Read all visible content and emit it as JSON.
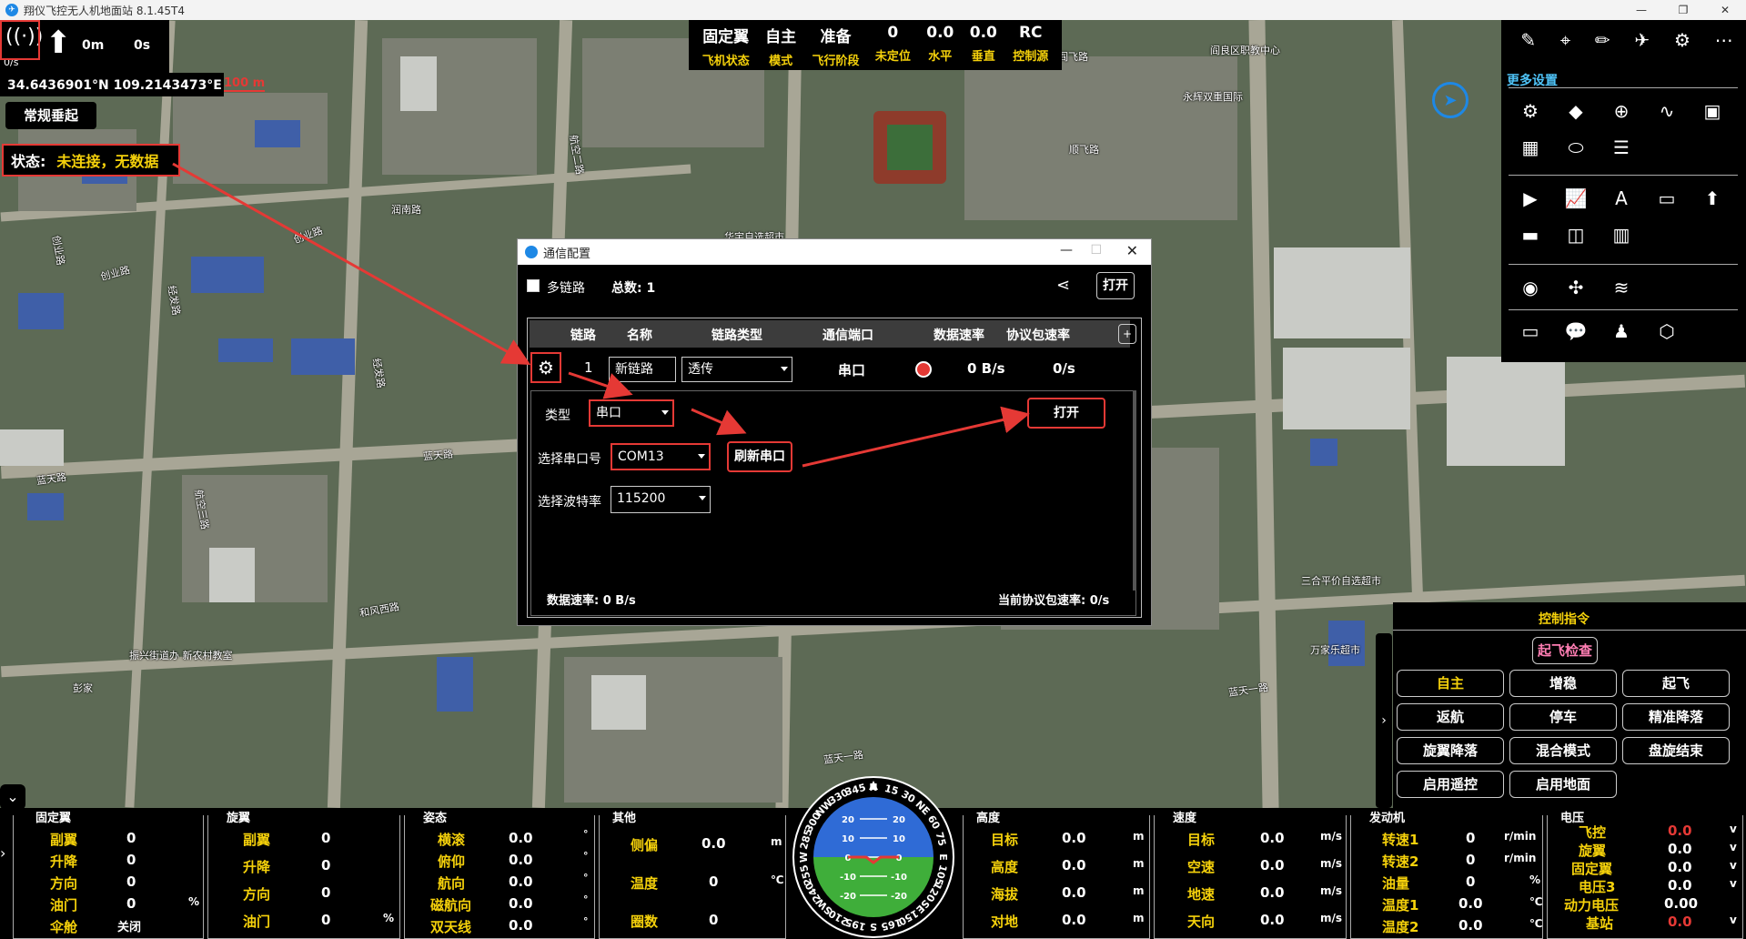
{
  "window": {
    "title": "翔仪飞控无人机地面站 8.1.45T4",
    "controls": [
      "—",
      "❐",
      "✕"
    ]
  },
  "top_left": {
    "signal": "0/s",
    "altitude": "0m",
    "time": "0s",
    "coords": "34.6436901°N 109.2143473°E",
    "scale": "100 m",
    "mode_button": "常规垂起",
    "status_label": "状态:",
    "status_value": "未连接，无数据"
  },
  "top_status": [
    {
      "value": "固定翼",
      "label": "飞机状态"
    },
    {
      "value": "自主",
      "label": "模式"
    },
    {
      "value": "准备",
      "label": "飞行阶段"
    },
    {
      "value": "0",
      "label": "未定位"
    },
    {
      "value": "0.0",
      "label": "水平"
    },
    {
      "value": "0.0",
      "label": "垂直"
    },
    {
      "value": "RC",
      "label": "控制源"
    }
  ],
  "right_panel": {
    "more_settings": "更多设置"
  },
  "map_labels": [
    "阎良区职教中心",
    "永辉双重国际",
    "航空二路",
    "华宇自选超市",
    "创业路",
    "润南路",
    "创业路",
    "经发路",
    "航空三路",
    "经发路",
    "创业路",
    "蓝天路",
    "蓝天路",
    "和风西路",
    "振兴街道办 新农村教室",
    "彭家",
    "三合平价自选超市",
    "万家乐超市",
    "蓝天一路",
    "蓝天一路",
    "顺飞路",
    "阎飞路"
  ],
  "dialog": {
    "title": "通信配置",
    "multi_link": "多链路",
    "total": "总数: 1",
    "open": "打开",
    "headers": [
      "链路",
      "名称",
      "链路类型",
      "通信端口",
      "数据速率",
      "协议包速率"
    ],
    "row": {
      "index": "1",
      "name": "新链路",
      "type": "透传",
      "port": "串口",
      "rate": "0 B/s",
      "pkt_rate": "0/s"
    },
    "detail": {
      "type_label": "类型",
      "type_value": "串口",
      "port_label": "选择串口号",
      "port_value": "COM13",
      "refresh": "刷新串口",
      "baud_label": "选择波特率",
      "baud_value": "115200",
      "open": "打开",
      "data_rate": "数据速率: 0 B/s",
      "pkt_rate": "当前协议包速率: 0/s"
    }
  },
  "control": {
    "title": "控制指令",
    "check": "起飞检查",
    "buttons": [
      "自主",
      "增稳",
      "起飞",
      "返航",
      "停车",
      "精准降落",
      "旋翼降落",
      "混合模式",
      "盘旋结束",
      "启用遥控",
      "启用地面"
    ]
  },
  "bottom": {
    "fixed_wing": {
      "title": "固定翼",
      "rows": [
        [
          "副翼",
          "0",
          ""
        ],
        [
          "升降",
          "0",
          ""
        ],
        [
          "方向",
          "0",
          ""
        ],
        [
          "油门",
          "0",
          "%"
        ],
        [
          "伞舱",
          "关闭",
          ""
        ]
      ]
    },
    "rotor": {
      "title": "旋翼",
      "rows": [
        [
          "副翼",
          "0",
          ""
        ],
        [
          "升降",
          "0",
          ""
        ],
        [
          "方向",
          "0",
          ""
        ],
        [
          "油门",
          "0",
          "%"
        ]
      ]
    },
    "attitude": {
      "title": "姿态",
      "rows": [
        [
          "横滚",
          "0.0",
          "°"
        ],
        [
          "俯仰",
          "0.0",
          "°"
        ],
        [
          "航向",
          "0.0",
          "°"
        ],
        [
          "磁航向",
          "0.0",
          "°"
        ],
        [
          "双天线",
          "0.0",
          "°"
        ]
      ]
    },
    "other": {
      "title": "其他",
      "rows": [
        [
          "侧偏",
          "0.0",
          "m"
        ],
        [
          "温度",
          "0",
          "℃"
        ],
        [
          "圈数",
          "0",
          ""
        ]
      ]
    },
    "height": {
      "title": "高度",
      "rows": [
        [
          "目标",
          "0.0",
          "m"
        ],
        [
          "高度",
          "0.0",
          "m"
        ],
        [
          "海拔",
          "0.0",
          "m"
        ],
        [
          "对地",
          "0.0",
          "m"
        ]
      ]
    },
    "speed": {
      "title": "速度",
      "rows": [
        [
          "目标",
          "0.0",
          "m/s"
        ],
        [
          "空速",
          "0.0",
          "m/s"
        ],
        [
          "地速",
          "0.0",
          "m/s"
        ],
        [
          "天向",
          "0.0",
          "m/s"
        ]
      ]
    },
    "engine": {
      "title": "发动机",
      "rows": [
        [
          "转速1",
          "0",
          "r/min"
        ],
        [
          "转速2",
          "0",
          "r/min"
        ],
        [
          "油量",
          "0",
          "%"
        ],
        [
          "温度1",
          "0.0",
          "℃"
        ],
        [
          "温度2",
          "0.0",
          "℃"
        ]
      ]
    },
    "power": {
      "title": "电压",
      "rows": [
        [
          "飞控",
          "0.0",
          "v"
        ],
        [
          "旋翼",
          "0.0",
          "v"
        ],
        [
          "固定翼",
          "0.0",
          "v"
        ],
        [
          "电压3",
          "0.0",
          "v"
        ],
        [
          "动力电压",
          "0.00",
          ""
        ],
        [
          "基站",
          "0.0",
          "v"
        ]
      ]
    },
    "compass": {
      "ring": [
        "N",
        "15",
        "30",
        "NE",
        "60",
        "75",
        "E",
        "105",
        "120",
        "SE",
        "150",
        "165",
        "S",
        "195",
        "210",
        "SW",
        "240",
        "255",
        "W",
        "285",
        "300",
        "NW",
        "330",
        "345"
      ],
      "ladder": [
        "20",
        "10",
        "0",
        "-10",
        "-20"
      ]
    }
  },
  "colors": {
    "accent_yellow": "#f5d10b",
    "alert_red": "#e53935",
    "sky_blue": "#2f6bd6",
    "ground_green": "#3fae3a"
  }
}
